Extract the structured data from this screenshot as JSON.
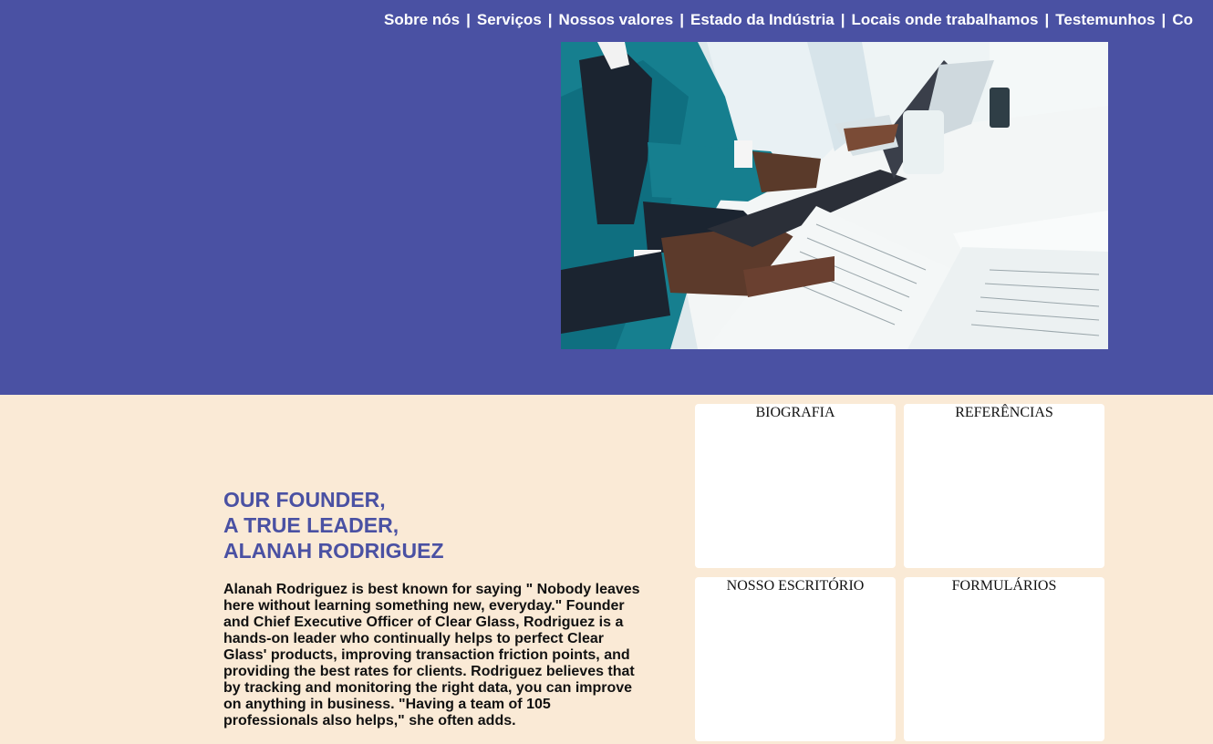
{
  "nav": {
    "items": [
      {
        "label": "Sobre nós"
      },
      {
        "label": "Serviços"
      },
      {
        "label": "Nossos valores"
      },
      {
        "label": "Estado da Indústria"
      },
      {
        "label": "Locais onde trabalhamos"
      },
      {
        "label": "Testemunhos"
      },
      {
        "label": "Co"
      }
    ],
    "separator": "|"
  },
  "founder": {
    "title_lines": [
      "OUR FOUNDER,",
      "A TRUE LEADER,",
      "ALANAH RODRIGUEZ"
    ],
    "bio": "Alanah Rodriguez is best known for saying \" Nobody leaves here without learning something new, everyday.\" Founder and Chief Executive Officer of Clear Glass, Rodriguez is a hands-on leader who continually helps to perfect Clear Glass' products, improving transaction friction points, and providing the best rates for clients. Rodriguez believes that by tracking and monitoring the right data, you can improve on anything in business. \"Having a team of 105 professionals also helps,\" she often adds."
  },
  "cards": [
    {
      "label": "BIOGRAFIA"
    },
    {
      "label": "REFERÊNCIAS"
    },
    {
      "label": "NOSSO ESCRITÓRIO"
    },
    {
      "label": "FORMULÁRIOS"
    }
  ],
  "colors": {
    "hero_background": "#4a51a3",
    "page_background": "#faead6",
    "heading_accent": "#4a51a3",
    "card_background": "#ffffff"
  }
}
